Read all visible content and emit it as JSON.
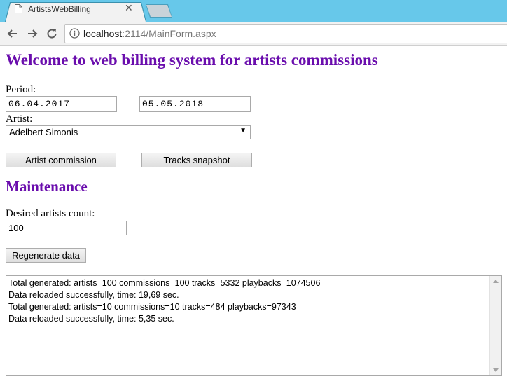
{
  "browser": {
    "tab_title": "ArtistsWebBilling",
    "url_host": "localhost",
    "url_rest": ":2114/MainForm.aspx"
  },
  "page": {
    "title": "Welcome to web billing system for artists commissions",
    "period_label": "Period:",
    "period_from": "06.04.2017",
    "period_to": "05.05.2018",
    "artist_label": "Artist:",
    "artist_selected": "Adelbert Simonis",
    "artist_commission_button": "Artist commission",
    "tracks_snapshot_button": "Tracks snapshot",
    "maintenance_title": "Maintenance",
    "desired_count_label": "Desired artists count:",
    "desired_count_value": "100",
    "regenerate_button": "Regenerate data",
    "log_lines": [
      "Total generated: artists=100 commissions=100 tracks=5332 playbacks=1074506",
      "Data reloaded successfully, time: 19,69 sec.",
      "Total generated: artists=10 commissions=10 tracks=484 playbacks=97343",
      "Data reloaded successfully, time: 5,35 sec."
    ]
  },
  "colors": {
    "heading": "#6a0dad",
    "tabbar": "#67c8ea"
  }
}
